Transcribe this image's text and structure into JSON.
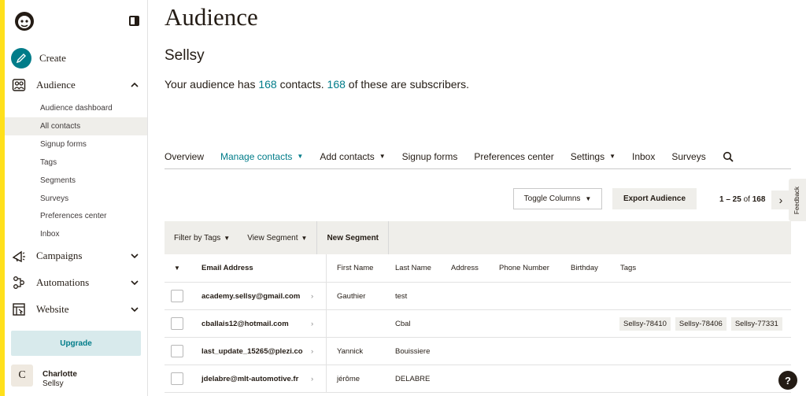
{
  "sidebar": {
    "nav": [
      {
        "label": "Create",
        "icon": "pencil-icon"
      },
      {
        "label": "Audience",
        "icon": "audience-icon"
      }
    ],
    "audience_items": [
      "Audience dashboard",
      "All contacts",
      "Signup forms",
      "Tags",
      "Segments",
      "Surveys",
      "Preferences center",
      "Inbox"
    ],
    "lower_nav": [
      {
        "label": "Campaigns",
        "icon": "megaphone-icon"
      },
      {
        "label": "Automations",
        "icon": "automations-icon"
      },
      {
        "label": "Website",
        "icon": "website-icon"
      }
    ],
    "upgrade_label": "Upgrade",
    "user": {
      "initial": "C",
      "name": "Charlotte",
      "org": "Sellsy"
    }
  },
  "page": {
    "title": "Audience",
    "audience_name": "Sellsy",
    "summary": {
      "prefix": "Your audience has ",
      "contacts": "168",
      "middle": " contacts. ",
      "subscribers": "168",
      "suffix": " of these are subscribers."
    }
  },
  "tabs": [
    {
      "label": "Overview",
      "dropdown": false
    },
    {
      "label": "Manage contacts",
      "dropdown": true,
      "active": true
    },
    {
      "label": "Add contacts",
      "dropdown": true
    },
    {
      "label": "Signup forms",
      "dropdown": false
    },
    {
      "label": "Preferences center",
      "dropdown": false
    },
    {
      "label": "Settings",
      "dropdown": true
    },
    {
      "label": "Inbox",
      "dropdown": false
    },
    {
      "label": "Surveys",
      "dropdown": false
    }
  ],
  "toolbar": {
    "toggle_columns": "Toggle Columns",
    "export": "Export Audience",
    "pager_range": "1 – 25",
    "pager_of": " of ",
    "pager_total": "168",
    "feedback": "Feedback"
  },
  "filters": {
    "filter_tags": "Filter by Tags",
    "view_segment": "View Segment",
    "new_segment": "New Segment"
  },
  "table": {
    "headers": {
      "email": "Email Address",
      "first": "First Name",
      "last": "Last Name",
      "address": "Address",
      "phone": "Phone Number",
      "birthday": "Birthday",
      "tags": "Tags"
    },
    "rows": [
      {
        "email": "academy.sellsy@gmail.com",
        "first": "Gauthier",
        "last": "test",
        "tags": []
      },
      {
        "email": "cballais12@hotmail.com",
        "first": "",
        "last": "Cbal",
        "tags": [
          "Sellsy-78410",
          "Sellsy-78406",
          "Sellsy-77331"
        ]
      },
      {
        "email": "last_update_15265@plezi.co",
        "first": "Yannick",
        "last": "Bouissiere",
        "tags": []
      },
      {
        "email": "jdelabre@mlt-automotive.fr",
        "first": "jérôme",
        "last": "DELABRE",
        "tags": []
      }
    ]
  },
  "help_label": "?",
  "colors": {
    "accent": "#007c89",
    "brand_yellow": "#ffe01b",
    "panel": "#efeeea"
  }
}
